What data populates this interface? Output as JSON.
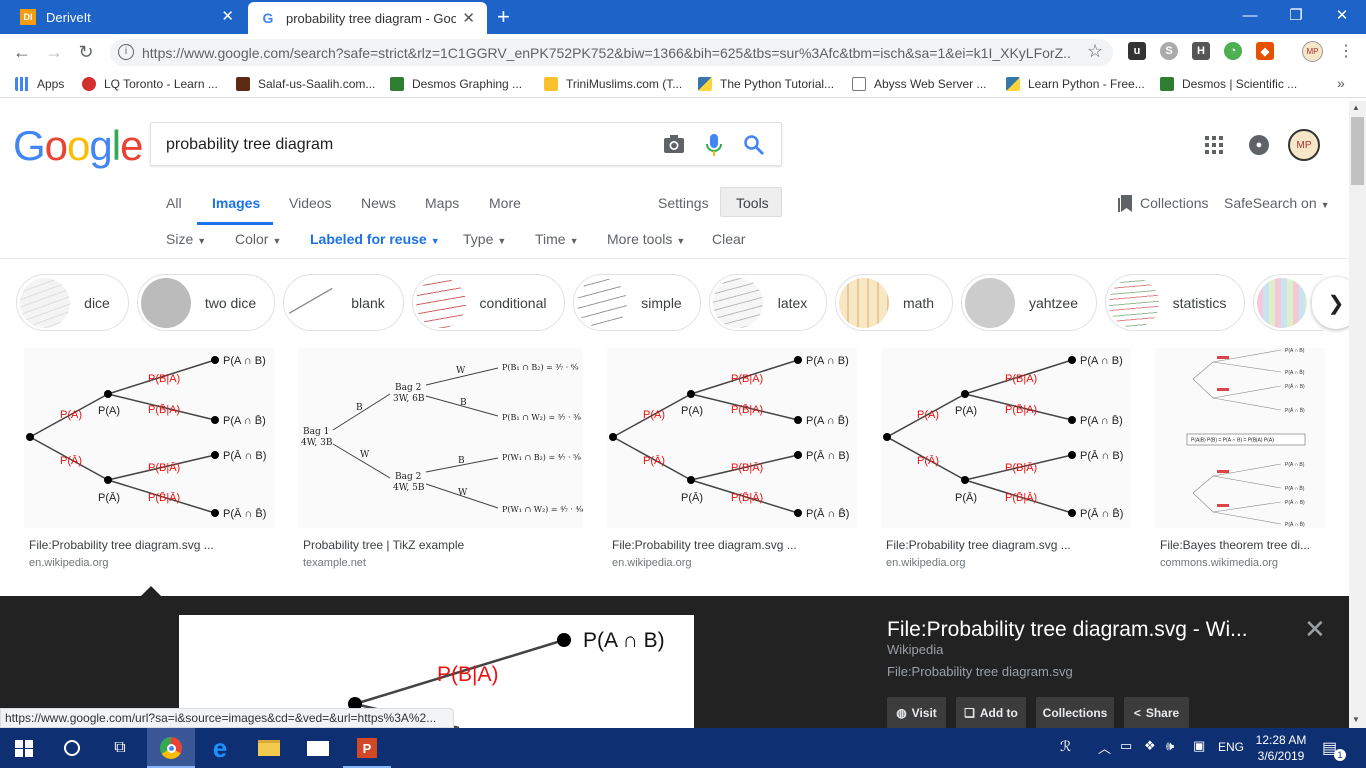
{
  "tabs": [
    {
      "title": "DeriveIt",
      "favicon": "DI"
    },
    {
      "title": "probability tree diagram - Googl",
      "favicon": "G"
    }
  ],
  "address": {
    "url": "https://www.google.com/search?safe=strict&rlz=1C1GGRV_enPK752PK752&biw=1366&bih=625&tbs=sur%3Afc&tbm=isch&sa=1&ei=k1I_XKyLForZ..."
  },
  "bookmarks": [
    {
      "label": "Apps",
      "icon": "apps-icon"
    },
    {
      "label": "LQ Toronto - Learn ...",
      "icon": "lq-icon"
    },
    {
      "label": "Salaf-us-Saalih.com...",
      "icon": "salaf-icon"
    },
    {
      "label": "Desmos Graphing ...",
      "icon": "desmos-icon"
    },
    {
      "label": "TriniMuslims.com (T...",
      "icon": "flag-icon"
    },
    {
      "label": "The Python Tutorial...",
      "icon": "python-icon"
    },
    {
      "label": "Abyss Web Server ...",
      "icon": "page-icon"
    },
    {
      "label": "Learn Python - Free...",
      "icon": "python-icon"
    },
    {
      "label": "Desmos | Scientific ...",
      "icon": "desmos-icon"
    }
  ],
  "google": {
    "query": "probability tree diagram",
    "nav": [
      "All",
      "Images",
      "Videos",
      "News",
      "Maps",
      "More"
    ],
    "settings": "Settings",
    "tools": "Tools",
    "collections": "Collections",
    "safesearch": "SafeSearch on",
    "filters": [
      "Size",
      "Color",
      "Labeled for reuse",
      "Type",
      "Time",
      "More tools"
    ],
    "clear": "Clear"
  },
  "chips": [
    "dice",
    "two dice",
    "blank",
    "conditional",
    "simple",
    "latex",
    "math",
    "yahtzee",
    "statistics"
  ],
  "results": [
    {
      "title": "File:Probability tree diagram.svg ...",
      "source": "en.wikipedia.org"
    },
    {
      "title": "Probability tree | TikZ example",
      "source": "texample.net"
    },
    {
      "title": "File:Probability tree diagram.svg ...",
      "source": "en.wikipedia.org"
    },
    {
      "title": "File:Probability tree diagram.svg ...",
      "source": "en.wikipedia.org"
    },
    {
      "title": "File:Bayes theorem tree di...",
      "source": "commons.wikimedia.org"
    }
  ],
  "tree": {
    "pa": "P(A)",
    "pabar": "P(Ā)",
    "pba": "P(B|A)",
    "pbbara": "P(B̄|A)",
    "pbabar": "P(B|Ā)",
    "pbbarabar": "P(B̄|Ā)",
    "ab": "P(A ∩ B)",
    "abbar": "P(A ∩ B̄)",
    "abarb": "P(Ā ∩ B)",
    "abarbbar": "P(Ā ∩ B̄)"
  },
  "tikz": {
    "bag1": "Bag 1",
    "bag1c": "4W, 3B",
    "bag2a": "Bag 2",
    "bag2ac": "3W, 6B",
    "bag2b": "Bag 2",
    "bag2bc": "4W, 5B",
    "b": "B",
    "w": "W",
    "out1": "P(B₁ ∩ B₂) = ³⁄₇ · ⁶⁄₉",
    "out2": "P(B₁ ∩ W₂) = ³⁄₇ · ³⁄₉",
    "out3": "P(W₁ ∩ B₂) = ⁴⁄₇ · ⁵⁄₉",
    "out4": "P(W₁ ∩ W₂) = ⁴⁄₇ · ⁴⁄₉"
  },
  "bayes": {
    "ab": "P(A ∩ B)",
    "abbar": "P(A ∩ B̄)",
    "abarb": "P(Ā ∩ B)",
    "abarbbar": "P(Ā ∩ B̄)",
    "formula": "P(A|B) P(B) = P(A ∩ B) = P(B|A) P(A)"
  },
  "panel": {
    "title": "File:Probability tree diagram.svg - Wi...",
    "source": "Wikipedia",
    "subtitle": "File:Probability tree diagram.svg",
    "buttons": [
      "Visit",
      "Add to",
      "Collections",
      "Share"
    ],
    "preview_ab": "P(A ∩ B)",
    "preview_ba": "P(B|A)"
  },
  "status_url": "https://www.google.com/url?sa=i&source=images&cd=&ved=&url=https%3A%2...",
  "taskbar": {
    "lang": "ENG",
    "time": "12:28 AM",
    "date": "3/6/2019",
    "notifications": "1"
  }
}
